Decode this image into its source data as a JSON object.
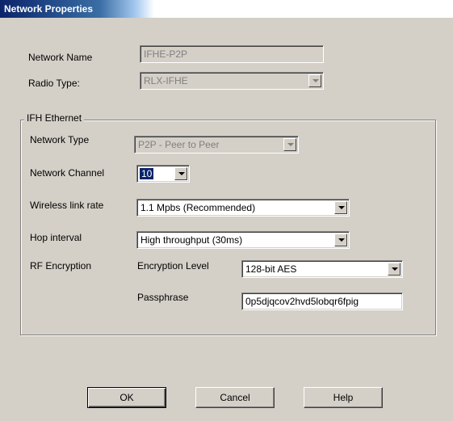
{
  "window": {
    "title": "Network Properties"
  },
  "fields": {
    "network_name_label": "Network Name",
    "network_name_value": "IFHE-P2P",
    "radio_type_label": "Radio Type:",
    "radio_type_value": "RLX-IFHE"
  },
  "group": {
    "label": "IFH Ethernet",
    "network_type_label": "Network Type",
    "network_type_value": "P2P - Peer to Peer",
    "network_channel_label": "Network Channel",
    "network_channel_value": "10",
    "wireless_link_rate_label": "Wireless link rate",
    "wireless_link_rate_value": "1.1 Mpbs (Recommended)",
    "hop_interval_label": "Hop interval",
    "hop_interval_value": "High throughput (30ms)",
    "rf_encryption_label": "RF Encryption",
    "encryption_level_label": "Encryption Level",
    "encryption_level_value": "128-bit AES",
    "passphrase_label": "Passphrase",
    "passphrase_value": "0p5djqcov2hvd5lobqr6fpig"
  },
  "buttons": {
    "ok": "OK",
    "cancel": "Cancel",
    "help": "Help"
  }
}
